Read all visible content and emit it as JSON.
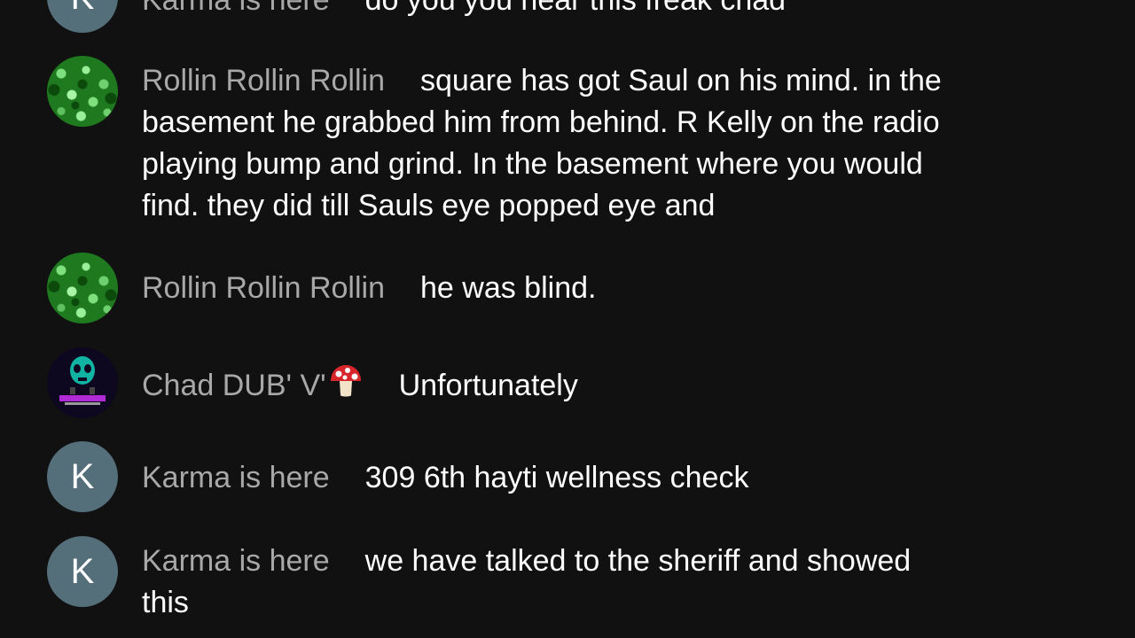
{
  "messages": [
    {
      "author": "Karma is here",
      "avatar_letter": "K",
      "lines": [
        "do you you hear this freak chad"
      ]
    },
    {
      "author": "Rollin Rollin Rollin",
      "lines": [
        "square has got Saul on his mind. in the",
        "basement he grabbed him from behind. R Kelly on the radio",
        "playing bump and grind. In the basement where you would",
        "find. they did till Sauls eye popped eye and"
      ]
    },
    {
      "author": "Rollin Rollin Rollin",
      "lines": [
        "he was blind."
      ]
    },
    {
      "author": "Chad DUB' V'",
      "author_emoji": "mushroom-icon",
      "avatar_text": "CHAD DUBV MEDIA WORLD",
      "lines": [
        "Unfortunately"
      ]
    },
    {
      "author": "Karma is here",
      "avatar_letter": "K",
      "lines": [
        "309 6th hayti wellness check"
      ]
    },
    {
      "author": "Karma is here",
      "avatar_letter": "K",
      "lines": [
        "we have talked to the sheriff and showed",
        "this"
      ]
    }
  ],
  "colors": {
    "background": "#111111",
    "author_text": "#a8a8a8",
    "message_text": "#ffffff",
    "letter_avatar_bg": "#546e7a"
  }
}
